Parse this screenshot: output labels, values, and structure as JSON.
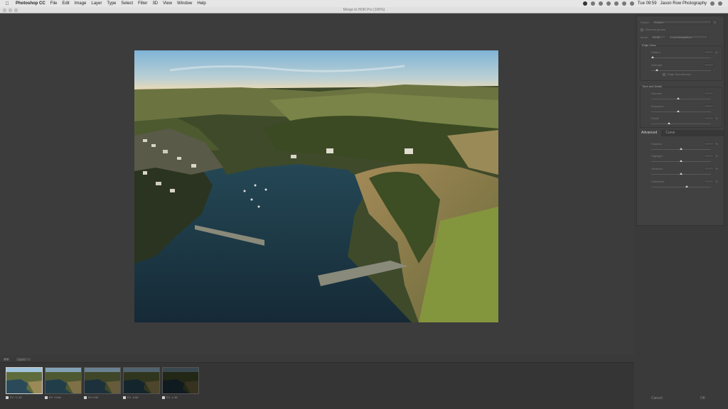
{
  "menubar": {
    "apple_icon": "apple-icon",
    "app_name": "Photoshop CC",
    "items": [
      "File",
      "Edit",
      "Image",
      "Layer",
      "Type",
      "Select",
      "Filter",
      "3D",
      "View",
      "Window",
      "Help"
    ],
    "clock": "Tue 09:59",
    "user": "Jason Row Photography"
  },
  "window": {
    "title": "Merge to HDR Pro (100%)"
  },
  "zoom": {
    "value": "100%"
  },
  "panel": {
    "preset_label": "Preset:",
    "preset_value": "Custom",
    "remove_ghosts_label": "Remove ghosts",
    "mode_label": "Mode:",
    "mode_value": "16 Bit",
    "method_value": "Local Adaptation",
    "edge_glow": {
      "title": "Edge Glow",
      "radius_label": "Radius:",
      "radius_unit": "px",
      "strength_label": "Strength:",
      "smoothness_label": "Edge Smoothness"
    },
    "tone_detail": {
      "title": "Tone and Detail",
      "gamma_label": "Gamma:",
      "exposure_label": "Exposure:",
      "detail_label": "Detail:",
      "detail_unit": "%"
    },
    "tabs": [
      "Advanced",
      "Curve"
    ],
    "advanced": {
      "shadow_label": "Shadow:",
      "highlight_label": "Highlight:",
      "vibrance_label": "Vibrance:",
      "saturation_label": "Saturation:",
      "unit": "%"
    },
    "slider_levels": {
      "radius": 0.02,
      "strength": 0.1,
      "gamma": 0.45,
      "exposure": 0.45,
      "detail": 0.3,
      "shadow": 0.5,
      "highlight": 0.5,
      "vibrance": 0.5,
      "saturation": 0.6
    }
  },
  "buttons": {
    "cancel": "Cancel",
    "ok": "OK"
  },
  "filmstrip": [
    {
      "label": "EV +1.33",
      "brightness": 1.0
    },
    {
      "label": "EV +0.66",
      "brightness": 0.82
    },
    {
      "label": "EV 0.00",
      "brightness": 0.66
    },
    {
      "label": "EV -0.66",
      "brightness": 0.5
    },
    {
      "label": "EV -1.36",
      "brightness": 0.36
    }
  ],
  "colors": {
    "workspace": "#3c3c3c",
    "panel": "#414141",
    "sky_top": "#7fb4d6",
    "sky_horizon": "#e9d9b8",
    "sea": "#1c3543"
  }
}
